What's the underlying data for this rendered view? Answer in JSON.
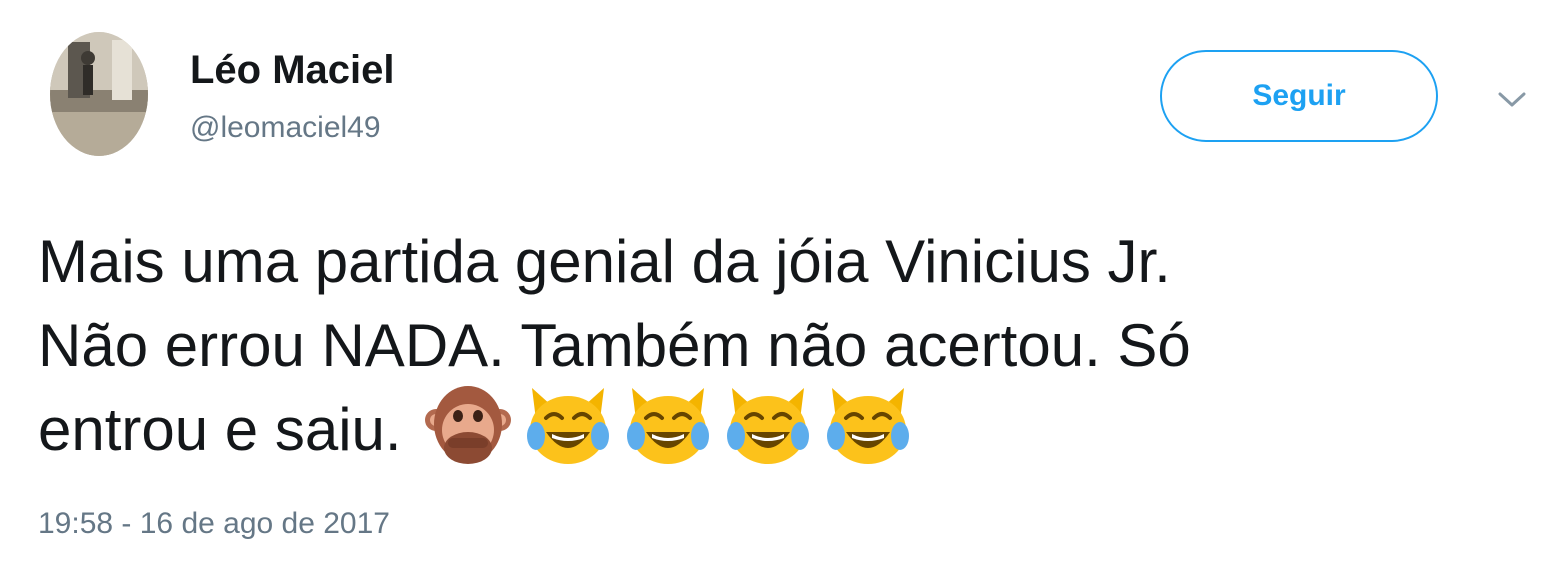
{
  "user": {
    "display_name": "Léo Maciel",
    "screen_name": "@leomaciel49",
    "avatar_icon": "user-avatar"
  },
  "actions": {
    "follow_label": "Seguir",
    "caret_icon": "chevron-down-icon"
  },
  "tweet": {
    "lines": [
      "Mais uma partida genial da jóia Vinicius Jr.",
      "Não errou NADA. Também não acertou. Só",
      "entrou e saiu."
    ],
    "emojis": [
      "see-no-evil-monkey-emoji",
      "cat-tears-of-joy-emoji",
      "cat-tears-of-joy-emoji",
      "cat-tears-of-joy-emoji",
      "cat-tears-of-joy-emoji"
    ],
    "timestamp": "19:58 - 16 de ago de 2017"
  },
  "colors": {
    "accent": "#1da1f2",
    "text": "#14171a",
    "secondary": "#657786"
  }
}
